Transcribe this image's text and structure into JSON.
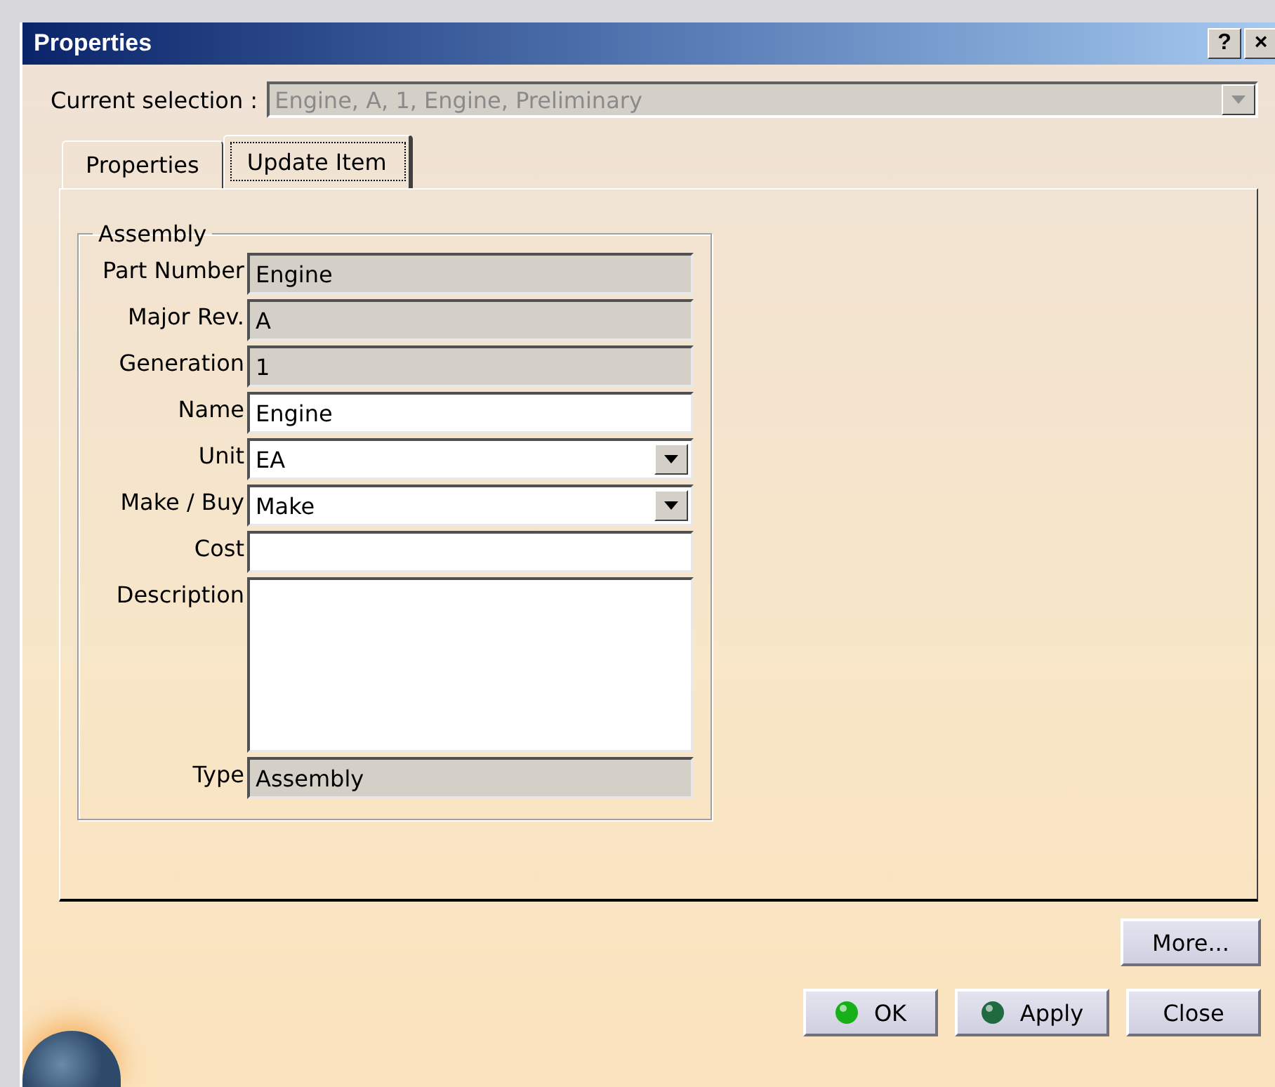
{
  "window": {
    "title": "Properties",
    "title_buttons": [
      "?",
      "×"
    ]
  },
  "current_selection": {
    "label": "Current selection :",
    "value": "Engine, A, 1, Engine, Preliminary",
    "disabled": true
  },
  "tabs": [
    {
      "label": "Properties",
      "selected": false
    },
    {
      "label": "Update Item",
      "selected": true
    }
  ],
  "group": {
    "title": "Assembly",
    "fields": [
      {
        "label": "Part Number",
        "value": "Engine",
        "kind": "readonly"
      },
      {
        "label": "Major Rev.",
        "value": "A",
        "kind": "readonly"
      },
      {
        "label": "Generation",
        "value": "1",
        "kind": "readonly"
      },
      {
        "label": "Name",
        "value": "Engine",
        "kind": "text"
      },
      {
        "label": "Unit",
        "value": "EA",
        "kind": "dropdown"
      },
      {
        "label": "Make / Buy",
        "value": "Make",
        "kind": "dropdown"
      },
      {
        "label": "Cost",
        "kind": "text"
      },
      {
        "label": "Description",
        "kind": "textarea"
      },
      {
        "label": "Type",
        "value": "Assembly",
        "kind": "readonly"
      }
    ]
  },
  "more_button": "More...",
  "buttons": [
    {
      "label": "OK",
      "kind": "ok"
    },
    {
      "label": "Apply",
      "kind": "apply"
    },
    {
      "label": "Close",
      "kind": "plain"
    }
  ]
}
